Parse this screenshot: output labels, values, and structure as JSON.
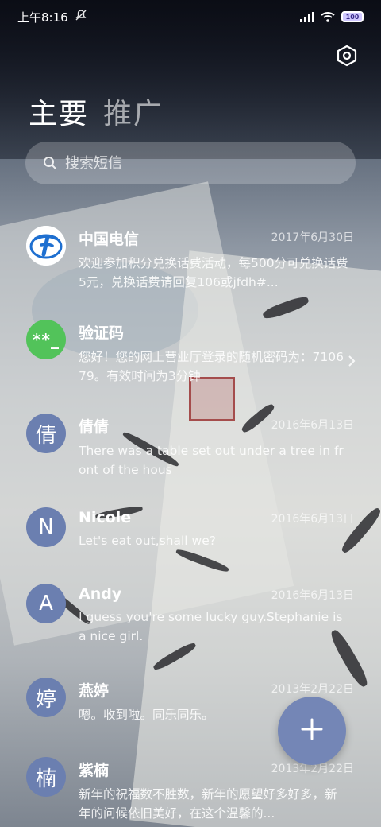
{
  "status_bar": {
    "time": "上午8:16",
    "battery": "100"
  },
  "tabs": [
    {
      "label": "主要"
    },
    {
      "label": "推广"
    }
  ],
  "search": {
    "placeholder": "搜索短信"
  },
  "conversations": [
    {
      "avatar_text": "",
      "avatar_icon": "china-telecom-logo",
      "name": "中国电信",
      "date": "2017年6月30日",
      "preview": "欢迎参加积分兑换话费活动，每500分可兑换话费5元，兑换话费请回复106或jfdh#..."
    },
    {
      "avatar_text": "**_",
      "name": "验证码",
      "date": "",
      "preview": "您好！您的网上营业厅登录的随机密码为：710679。有效时间为3分钟"
    },
    {
      "avatar_text": "倩",
      "name": "倩倩",
      "date": "2016年6月13日",
      "preview": "There was a table set out under a tree in front of the hous"
    },
    {
      "avatar_text": "N",
      "name": "Nicole",
      "date": "2016年6月13日",
      "preview": "Let's eat out,shall we?"
    },
    {
      "avatar_text": "A",
      "name": "Andy",
      "date": "2016年6月13日",
      "preview": "I guess you're some lucky guy.Stephanie is a nice girl."
    },
    {
      "avatar_text": "婷",
      "name": "燕婷",
      "date": "2013年2月22日",
      "preview": "嗯。收到啦。同乐同乐。"
    },
    {
      "avatar_text": "楠",
      "name": "紫楠",
      "date": "2013年2月22日",
      "preview": "新年的祝福数不胜数，新年的愿望好多好多，新年的问候依旧美好，在这个温馨的..."
    }
  ],
  "fab": {
    "icon": "plus-icon"
  },
  "colors": {
    "avatar": "#6b7fb0",
    "verification_avatar": "#52c35a",
    "fab": "#7486b6",
    "telecom_blue": "#1e6fd0"
  }
}
